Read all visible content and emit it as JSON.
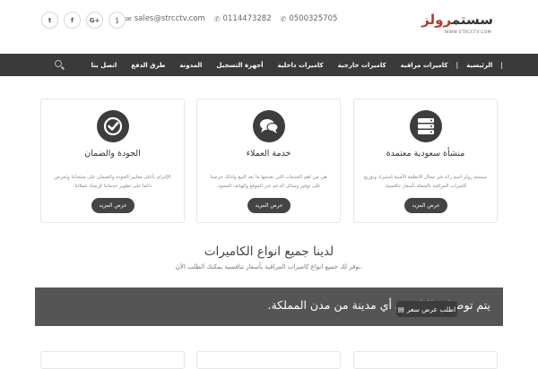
{
  "topbar": {
    "socials": [
      {
        "icon": "twitter-icon",
        "glyph": "t"
      },
      {
        "icon": "facebook-icon",
        "glyph": "f"
      },
      {
        "icon": "google-plus-icon",
        "glyph": "G+"
      },
      {
        "icon": "rss-icon",
        "glyph": "⟆"
      }
    ],
    "email": "sales@strcctv.com",
    "phone1": "0114473282",
    "phone2": "0500325705",
    "logo_main_a": "سستم",
    "logo_main_b": "رولز",
    "logo_sub": "WWW.STRCCTV.COM"
  },
  "nav": {
    "items": [
      "الرئيسية",
      "كاميرات مراقبة",
      "كاميرات خارجية",
      "كاميرات داخلية",
      "أجهزة التسجيل",
      "المدونة",
      "طرق الدفع",
      "اتصل بنا"
    ]
  },
  "cards": [
    {
      "icon": "server-icon",
      "title": "منشأة سعودية معتمدة",
      "text": "سستم رولز اسم رائد في مجال الانظمة الأمنية استيراد وتوزيع كاميرات المراقبة بالجملة بأسعار تنافسية.",
      "button": "عرض المزيد"
    },
    {
      "icon": "chat-icon",
      "title": "خدمة العملاء",
      "text": "هي من اهم الخدمات التي نقدمها ما بعد البيع ولذلك حرصنا على توفير وسائل الدعم عبر الموقع والهاتف المجود.",
      "button": "عرض المزيد"
    },
    {
      "icon": "check-icon",
      "title": "الجودة والضمان",
      "text": "الإلتزام بأعلى معايير الجودة والضمان على منتجاتنا وتحرص دائما على تطوير خدماتنا لإرضاء عملائنا.",
      "button": "عرض المزيد"
    }
  ],
  "section": {
    "title": "لدينا جميع انواع الكاميرات",
    "subtitle": "نوفر لك جميع انواع كاميرات المراقبة بأسعار تنافسية يمكنك الطلب الأن."
  },
  "banner": {
    "text": "يتم توصيل طلبك في أي مدينة من مدن المملكة.",
    "button": "اطلب عرض سعر"
  }
}
